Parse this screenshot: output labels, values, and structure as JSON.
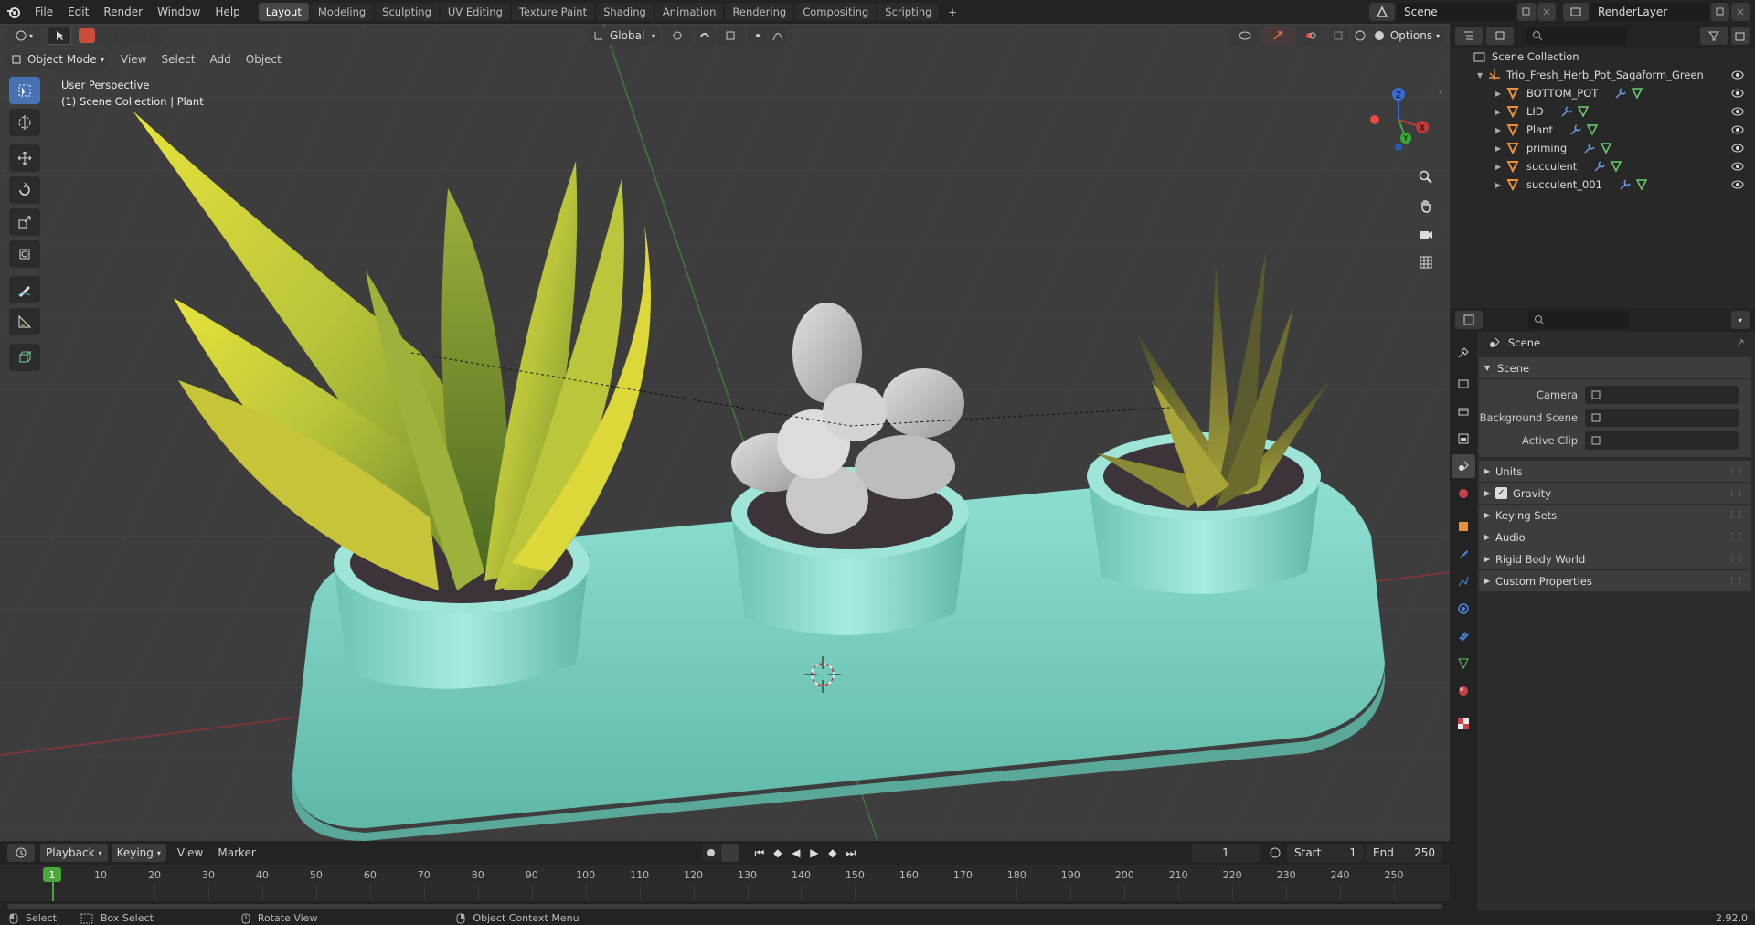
{
  "topbar": {
    "menus": [
      "File",
      "Edit",
      "Render",
      "Window",
      "Help"
    ],
    "workspaces": [
      "Layout",
      "Modeling",
      "Sculpting",
      "UV Editing",
      "Texture Paint",
      "Shading",
      "Animation",
      "Rendering",
      "Compositing",
      "Scripting"
    ],
    "active_workspace": "Layout",
    "add_tab": "+",
    "scene": "Scene",
    "render_layer": "RenderLayer"
  },
  "viewport_header": {
    "mode": "Object Mode",
    "menus": [
      "View",
      "Select",
      "Add",
      "Object"
    ],
    "transform_orientation": "Global",
    "options": "Options"
  },
  "viewport": {
    "info_line1": "User Perspective",
    "info_line2": "(1) Scene Collection | Plant",
    "gizmo": {
      "z": "Z",
      "x": "X",
      "y": "Y"
    }
  },
  "outliner": {
    "root": "Scene Collection",
    "collection": "Trio_Fresh_Herb_Pot_Sagaform_Green",
    "objects": [
      "BOTTOM_POT",
      "LID",
      "Plant",
      "priming",
      "succulent",
      "succulent_001"
    ]
  },
  "properties": {
    "context": "Scene",
    "panel_title": "Scene",
    "fields": [
      {
        "label": "Camera",
        "value": ""
      },
      {
        "label": "Background Scene",
        "value": ""
      },
      {
        "label": "Active Clip",
        "value": ""
      }
    ],
    "sections": [
      {
        "label": "Units",
        "checkbox": false
      },
      {
        "label": "Gravity",
        "checkbox": true
      },
      {
        "label": "Keying Sets",
        "checkbox": false
      },
      {
        "label": "Audio",
        "checkbox": false
      },
      {
        "label": "Rigid Body World",
        "checkbox": false
      },
      {
        "label": "Custom Properties",
        "checkbox": false
      }
    ]
  },
  "timeline": {
    "menus": [
      "Playback",
      "Keying",
      "View",
      "Marker"
    ],
    "current_frame": "1",
    "start_label": "Start",
    "start": "1",
    "end_label": "End",
    "end": "250",
    "ticks": [
      "1",
      "10",
      "20",
      "30",
      "40",
      "50",
      "60",
      "70",
      "80",
      "90",
      "100",
      "110",
      "120",
      "130",
      "140",
      "150",
      "160",
      "170",
      "180",
      "190",
      "200",
      "210",
      "220",
      "230",
      "240",
      "250"
    ],
    "playhead_label": "1"
  },
  "statusbar": {
    "select": "Select",
    "box_select": "Box Select",
    "rotate": "Rotate View",
    "context_menu": "Object Context Menu",
    "version": "2.92.0"
  },
  "colors": {
    "accent": "#4772b3",
    "pot": "#7fd8c8",
    "x_axis": "#c03a3a",
    "y_axis": "#3aa83a",
    "z_axis": "#3a6ad8",
    "object_icon": "#e8903c"
  }
}
